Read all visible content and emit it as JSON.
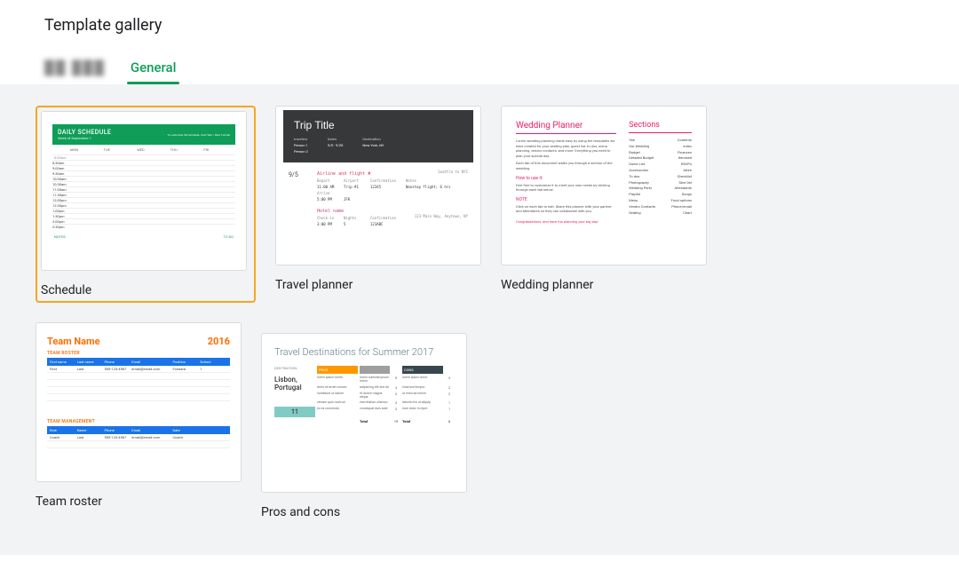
{
  "page_title": "Template gallery",
  "tabs": {
    "blurred_placeholder": "██ ███",
    "general": "General"
  },
  "templates": [
    {
      "label": "Schedule",
      "highlighted": true,
      "schedule": {
        "banner_title": "DAILY SCHEDULE",
        "banner_sub": "Week of  September 1"
      }
    },
    {
      "label": "Travel planner",
      "travel": {
        "title": "Trip Title",
        "travelers": "travelers",
        "person1": "Person 1",
        "person2": "Person 2",
        "dates_label": "Dates",
        "dates": "9/5 - 9/20",
        "dest_label": "Destination",
        "dest": "New York, NY",
        "day_date": "9/5",
        "flight_h": "Airline and flight #",
        "flight_right": "Seattle to NYC",
        "cols": [
          "Depart",
          "Airport",
          "Confirmation",
          "Notes"
        ],
        "row1": [
          "11:00 AM",
          "Trip #1",
          "12345",
          "Nonstop flight; 6 hrs"
        ],
        "arrive_label": "Arrive",
        "arrive_time": "5:00 PM",
        "arrive_ap": "JFK",
        "hotel_h": "Hotel name",
        "hotel_addr": "123 Main Way, Anytown, NY",
        "hotel_cols": [
          "Check-in",
          "Nights",
          "Confirmation"
        ],
        "hotel_row": [
          "3:00 PM",
          "5",
          "123ABC"
        ]
      }
    },
    {
      "label": "Wedding planner",
      "wedding": {
        "title": "Wedding Planner",
        "sections": "Sections"
      }
    },
    {
      "label": "Team roster",
      "roster": {
        "team_name": "Team Name",
        "year": "2016",
        "section1": "TEAM ROSTER",
        "section2": "TEAM MANAGEMENT",
        "columns": [
          "First name",
          "Last name",
          "Phone",
          "Email",
          "Position",
          "School"
        ]
      }
    },
    {
      "label": "Pros and cons",
      "proscons": {
        "title": "Travel Destinations for Summer 2017",
        "dest_label": "DESTINATION",
        "dest": "Lisbon, Portugal",
        "score": "11",
        "pros_label": "PROS",
        "cons_label": "CONS",
        "total_label": "Total"
      }
    }
  ]
}
